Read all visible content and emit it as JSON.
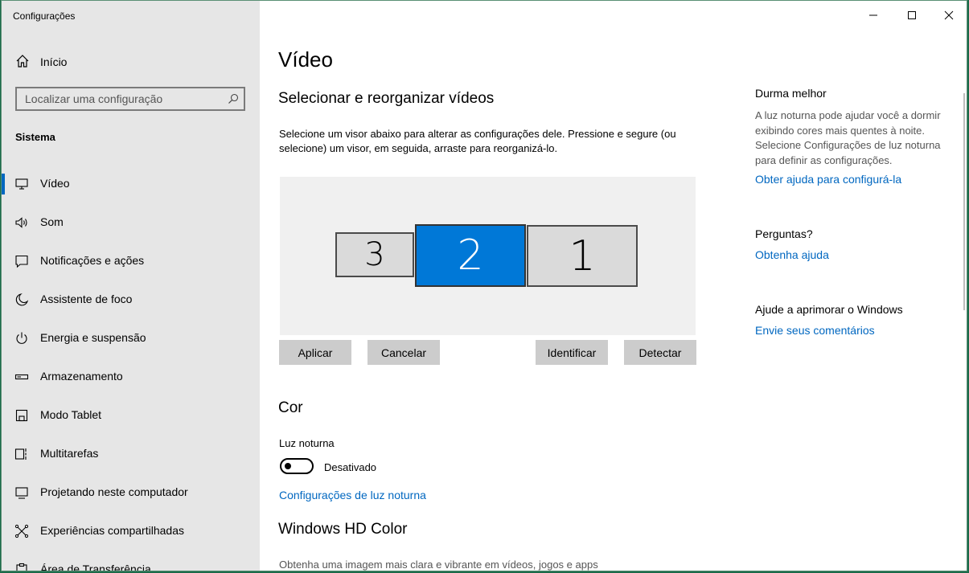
{
  "window": {
    "title": "Configurações"
  },
  "sidebar": {
    "home_label": "Início",
    "search_placeholder": "Localizar uma configuração",
    "section": "Sistema",
    "items": [
      {
        "label": "Vídeo",
        "icon": "monitor-icon",
        "active": true
      },
      {
        "label": "Som",
        "icon": "speaker-icon"
      },
      {
        "label": "Notificações e ações",
        "icon": "notification-icon"
      },
      {
        "label": "Assistente de foco",
        "icon": "moon-icon"
      },
      {
        "label": "Energia e suspensão",
        "icon": "power-icon"
      },
      {
        "label": "Armazenamento",
        "icon": "storage-icon"
      },
      {
        "label": "Modo Tablet",
        "icon": "tablet-icon"
      },
      {
        "label": "Multitarefas",
        "icon": "multitask-icon"
      },
      {
        "label": "Projetando neste computador",
        "icon": "project-icon"
      },
      {
        "label": "Experiências compartilhadas",
        "icon": "shared-icon"
      },
      {
        "label": "Área de Transferência",
        "icon": "clipboard-icon"
      }
    ]
  },
  "main": {
    "title": "Vídeo",
    "arrange_heading": "Selecionar e reorganizar vídeos",
    "arrange_desc": "Selecione um visor abaixo para alterar as configurações dele. Pressione e segure (ou selecione) um visor, em seguida, arraste para reorganizá-lo.",
    "monitors": [
      "3",
      "2",
      "1"
    ],
    "selected_monitor": "2",
    "buttons": {
      "apply": "Aplicar",
      "cancel": "Cancelar",
      "identify": "Identificar",
      "detect": "Detectar"
    },
    "color_heading": "Cor",
    "night_light_label": "Luz noturna",
    "night_light_state": "Desativado",
    "night_light_link": "Configurações de luz noturna",
    "hd_heading": "Windows HD Color",
    "hd_desc": "Obtenha uma imagem mais clara e vibrante em vídeos, jogos e apps"
  },
  "right_panel": {
    "sleep_title": "Durma melhor",
    "sleep_text": "A luz noturna pode ajudar você a dormir exibindo cores mais quentes à noite. Selecione Configurações de luz noturna para definir as configurações.",
    "sleep_link": "Obter ajuda para configurá-la",
    "questions_title": "Perguntas?",
    "questions_link": "Obtenha ajuda",
    "improve_title": "Ajude a aprimorar o Windows",
    "improve_link": "Envie seus comentários"
  },
  "colors": {
    "accent": "#0078d7",
    "link": "#0067c0",
    "sidebar_bg": "#e6e6e6"
  }
}
